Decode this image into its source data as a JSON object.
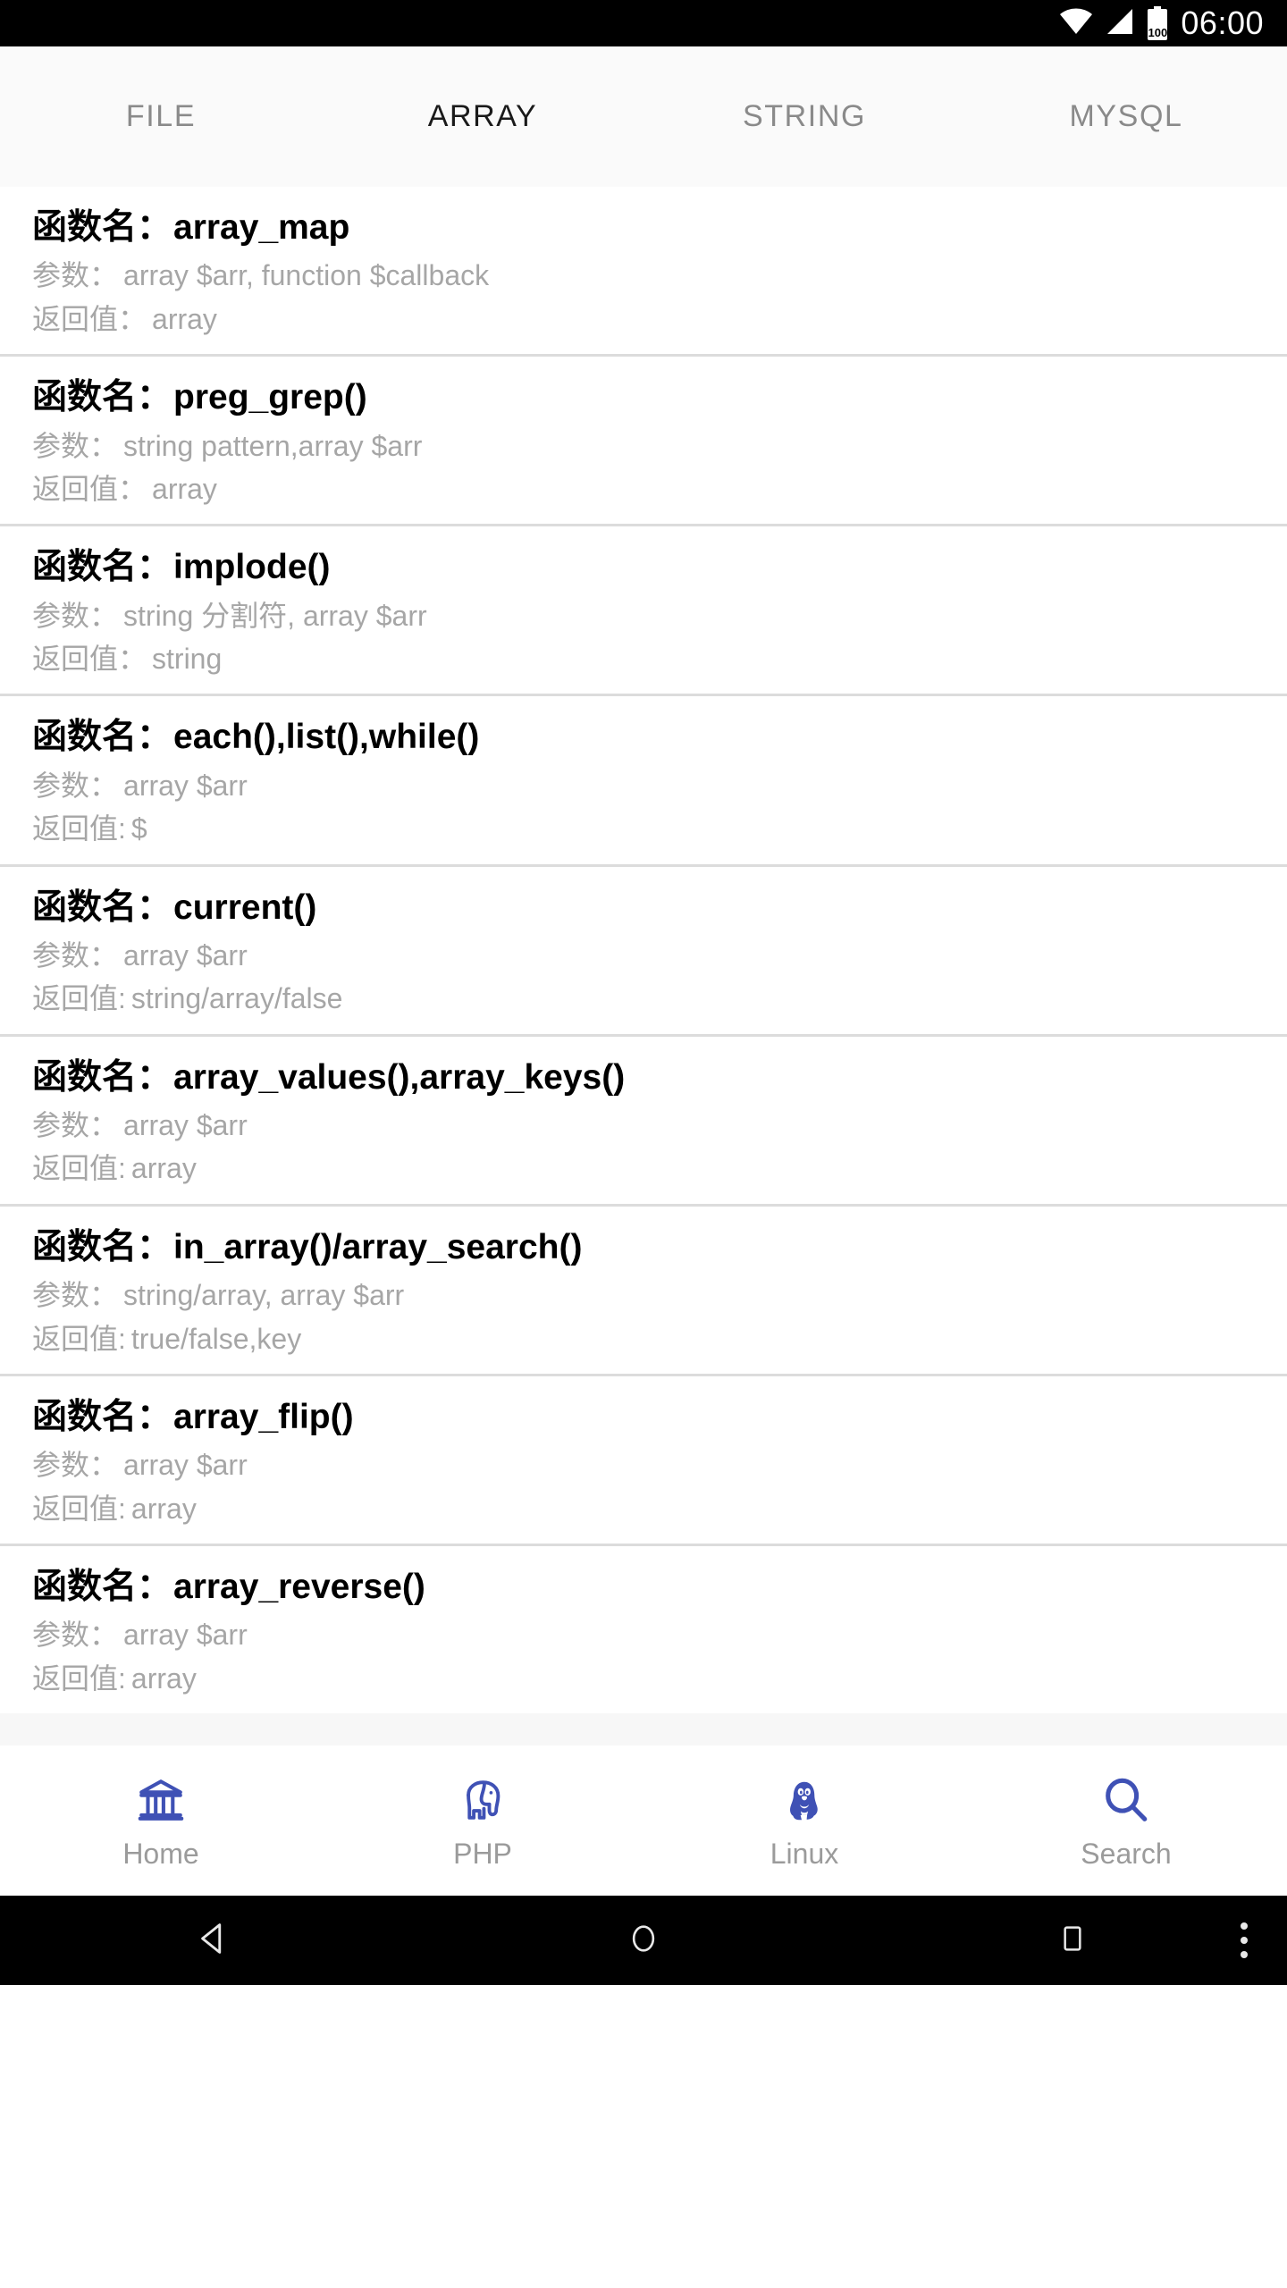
{
  "status_bar": {
    "time": "06:00",
    "battery_level": "100",
    "icons": [
      "wifi-icon",
      "signal-icon",
      "battery-icon"
    ]
  },
  "tabs": [
    {
      "label": "FILE",
      "active": false
    },
    {
      "label": "ARRAY",
      "active": true
    },
    {
      "label": "STRING",
      "active": false
    },
    {
      "label": "MYSQL",
      "active": false
    }
  ],
  "labels": {
    "function_name": "函数名：",
    "params": "参数：",
    "returns": "返回值：",
    "returns_alt": "返回值:"
  },
  "list": [
    {
      "name_label": "函数名：",
      "name": "array_map",
      "params_label": "参数：",
      "params": "array $arr, function $callback",
      "returns_label": "返回值：",
      "returns": "array"
    },
    {
      "name_label": "函数名：",
      "name": "preg_grep()",
      "params_label": "参数：",
      "params": "string pattern,array $arr",
      "returns_label": "返回值：",
      "returns": "array"
    },
    {
      "name_label": "函数名：",
      "name": "implode()",
      "params_label": "参数：",
      "params": "string 分割符, array $arr",
      "returns_label": "返回值：",
      "returns": "string"
    },
    {
      "name_label": "函数名：",
      "name": "each(),list(),while()",
      "params_label": "参数：",
      "params": "array $arr",
      "returns_label": "返回值:",
      "returns": "$"
    },
    {
      "name_label": "函数名：",
      "name": "current()",
      "params_label": "参数：",
      "params": "array $arr",
      "returns_label": "返回值:",
      "returns": "string/array/false"
    },
    {
      "name_label": "函数名：",
      "name": "array_values(),array_keys()",
      "params_label": "参数：",
      "params": "array $arr",
      "returns_label": "返回值:",
      "returns": "array"
    },
    {
      "name_label": "函数名：",
      "name": "in_array()/array_search()",
      "params_label": "参数：",
      "params": "string/array, array $arr",
      "returns_label": "返回值:",
      "returns": "true/false,key"
    },
    {
      "name_label": "函数名：",
      "name": "array_flip()",
      "params_label": "参数：",
      "params": "array $arr",
      "returns_label": "返回值:",
      "returns": "array"
    },
    {
      "name_label": "函数名：",
      "name": "array_reverse()",
      "params_label": "参数：",
      "params": "array $arr",
      "returns_label": "返回值:",
      "returns": "array"
    }
  ],
  "bottom_nav": [
    {
      "label": "Home",
      "icon": "bank-icon"
    },
    {
      "label": "PHP",
      "icon": "elephant-icon"
    },
    {
      "label": "Linux",
      "icon": "penguin-icon"
    },
    {
      "label": "Search",
      "icon": "magnifier-icon"
    }
  ],
  "android_nav": {
    "back": "back-triangle-icon",
    "home": "home-circle-icon",
    "recents": "recents-square-icon",
    "overflow": "overflow-dots-icon"
  },
  "colors": {
    "accent": "#3f51b5",
    "tab_active": "#1a1a1a",
    "tab_inactive": "#8a8a8a",
    "muted_text": "#a6a6a6",
    "divider": "#dcdcdc",
    "tab_bar_bg": "#fafafa",
    "status_bg": "#000000"
  }
}
